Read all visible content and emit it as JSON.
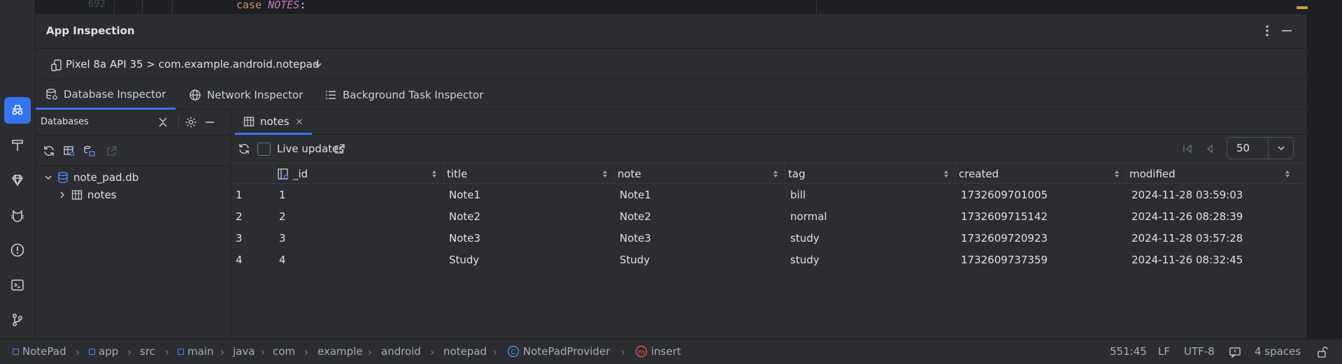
{
  "editor": {
    "line_number": "692",
    "code_keyword": "case",
    "code_constant": "NOTES",
    "code_colon": ":"
  },
  "panel": {
    "title": "App Inspection"
  },
  "device": {
    "label": "Pixel 8a API 35 > com.example.android.notepad"
  },
  "inspector_tabs": [
    {
      "label": "Database Inspector",
      "icon": "database-icon",
      "active": true
    },
    {
      "label": "Network Inspector",
      "icon": "globe-icon",
      "active": false
    },
    {
      "label": "Background Task Inspector",
      "icon": "list-icon",
      "active": false
    }
  ],
  "databases": {
    "title": "Databases",
    "tree": [
      {
        "label": "note_pad.db",
        "icon": "database-icon",
        "expanded": true
      },
      {
        "label": "notes",
        "icon": "table-icon",
        "expanded": false
      }
    ]
  },
  "table_tab": {
    "label": "notes"
  },
  "toolbar": {
    "live_updates_label": "Live updates",
    "page_size": "50"
  },
  "table": {
    "columns": [
      "_id",
      "title",
      "note",
      "tag",
      "created",
      "modified"
    ],
    "rows": [
      {
        "row": "1",
        "cells": [
          "1",
          "Note1",
          "Note1",
          "bill",
          "1732609701005",
          "2024-11-28 03:59:03"
        ]
      },
      {
        "row": "2",
        "cells": [
          "2",
          "Note2",
          "Note2",
          "normal",
          "1732609715142",
          "2024-11-26 08:28:39"
        ]
      },
      {
        "row": "3",
        "cells": [
          "3",
          "Note3",
          "Note3",
          "study",
          "1732609720923",
          "2024-11-28 03:57:28"
        ]
      },
      {
        "row": "4",
        "cells": [
          "4",
          "Study",
          "Study",
          "study",
          "1732609737359",
          "2024-11-26 08:32:45"
        ]
      }
    ]
  },
  "statusbar": {
    "breadcrumbs": [
      "NotePad",
      "app",
      "src",
      "main",
      "java",
      "com",
      "example",
      "android",
      "notepad",
      "NotePadProvider",
      "insert"
    ],
    "position": "551:45",
    "line_ending": "LF",
    "encoding": "UTF-8",
    "indent": "4 spaces"
  },
  "colors": {
    "accent": "#3574f0",
    "panel_bg": "#2b2d30",
    "editor_bg": "#1e1f22"
  }
}
